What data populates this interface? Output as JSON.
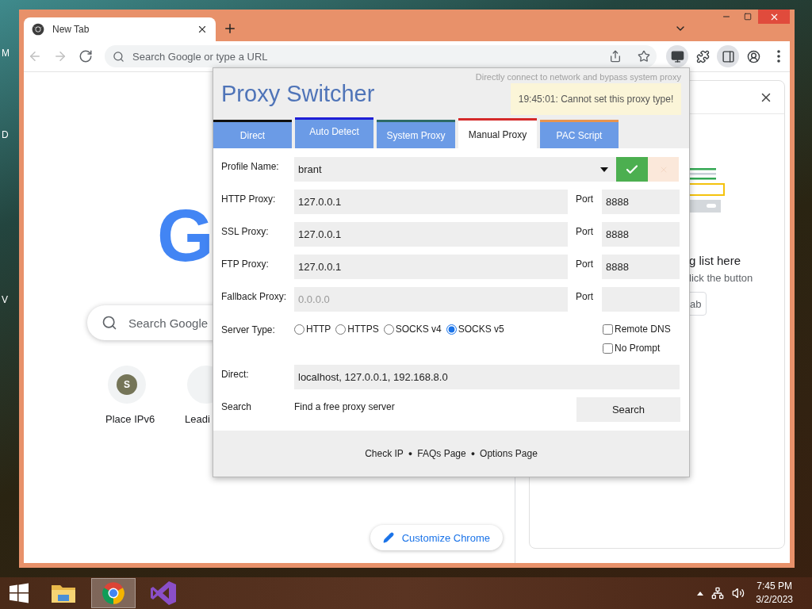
{
  "desktop": {
    "icon_labels": [
      "M",
      "D",
      "V"
    ]
  },
  "browser": {
    "tabs": [
      {
        "title": "New Tab",
        "selected": true
      }
    ],
    "nav": [
      {
        "kind": "back",
        "disabled": true
      },
      {
        "kind": "forward",
        "disabled": true
      },
      {
        "kind": "reload",
        "disabled": false
      }
    ],
    "address_bar": {
      "placeholder": "Search Google or type a URL"
    },
    "toolbar_buttons": [
      {
        "kind": "extension",
        "active": true
      },
      {
        "kind": "puzzle",
        "active": false
      },
      {
        "kind": "side_panel",
        "active": true
      },
      {
        "kind": "profile",
        "active": false
      },
      {
        "kind": "menu",
        "active": false
      }
    ],
    "page": {
      "logo": "G",
      "search": {
        "placeholder": "Search Google"
      },
      "shortcuts": [
        {
          "initial": "S",
          "label": "Place IPv6"
        },
        {
          "label": "Leadi"
        }
      ],
      "customize_button": "Customize Chrome"
    },
    "side_panel": {
      "heading": "g list here",
      "text": "lick the button",
      "button": "ab"
    }
  },
  "popup": {
    "title": "Proxy Switcher",
    "subtitle": "Directly connect to network and bypass system proxy",
    "toast": "19:45:01: Cannot set this proxy type!",
    "tabs": [
      {
        "label": "Direct",
        "color": "#111111",
        "selected": false,
        "hovered": false
      },
      {
        "label": "Auto Detect",
        "color": "#1f1fd6",
        "selected": false,
        "hovered": true
      },
      {
        "label": "System Proxy",
        "color": "#2e6b66",
        "selected": false,
        "hovered": false
      },
      {
        "label": "Manual Proxy",
        "color": "#d42a2a",
        "selected": true,
        "hovered": false
      },
      {
        "label": "PAC Script",
        "color": "#e8944e",
        "selected": false,
        "hovered": false
      }
    ],
    "profile": {
      "label": "Profile Name:",
      "value": "brant"
    },
    "proxies": [
      {
        "label": "HTTP Proxy:",
        "value": "127.0.0.1",
        "port_label": "Port",
        "port": "8888"
      },
      {
        "label": "SSL Proxy:",
        "value": "127.0.0.1",
        "port_label": "Port",
        "port": "8888"
      },
      {
        "label": "FTP Proxy:",
        "value": "127.0.0.1",
        "port_label": "Port",
        "port": "8888"
      },
      {
        "label": "Fallback Proxy:",
        "placeholder": "0.0.0.0",
        "port_label": "Port"
      }
    ],
    "server_type": {
      "label": "Server Type:",
      "options": [
        {
          "label": "HTTP",
          "selected": false
        },
        {
          "label": "HTTPS",
          "selected": false
        },
        {
          "label": "SOCKS v4",
          "selected": false
        },
        {
          "label": "SOCKS v5",
          "selected": true
        }
      ]
    },
    "options": [
      {
        "label": "Remote DNS",
        "checked": false
      },
      {
        "label": "No Prompt",
        "checked": false
      }
    ],
    "direct": {
      "label": "Direct:",
      "value": "localhost, 127.0.0.1, 192.168.8.0"
    },
    "search": {
      "label": "Search",
      "text": "Find a free proxy server",
      "button": "Search"
    },
    "footer": [
      {
        "kind": "link",
        "text": "Check IP"
      },
      {
        "kind": "separator",
        "text": "●"
      },
      {
        "kind": "link",
        "text": "FAQs Page"
      },
      {
        "kind": "separator",
        "text": "●"
      },
      {
        "kind": "link",
        "text": "Options Page"
      }
    ]
  },
  "taskbar": {
    "apps": [
      {
        "kind": "explorer",
        "selected": false
      },
      {
        "kind": "chrome",
        "selected": true
      },
      {
        "kind": "studio",
        "selected": false
      }
    ],
    "clock": {
      "time": "7:45 PM",
      "date": "3/2/2023"
    }
  }
}
